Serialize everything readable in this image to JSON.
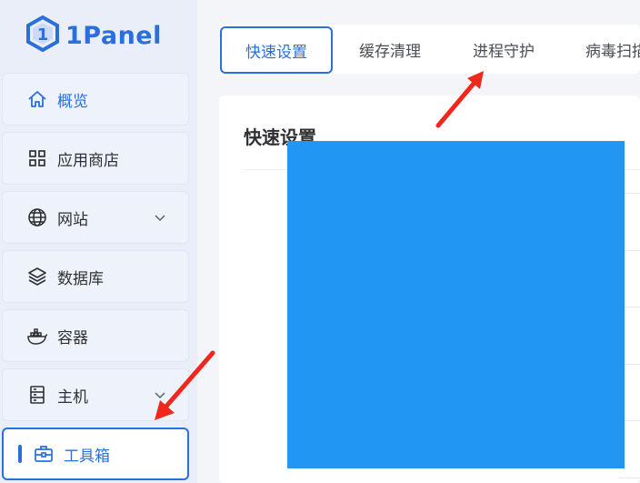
{
  "brand": {
    "name": "1Panel",
    "color": "#2a6fdb"
  },
  "sidebar": {
    "items": [
      {
        "label": "概览",
        "icon": "home-icon"
      },
      {
        "label": "应用商店",
        "icon": "grid-icon"
      },
      {
        "label": "网站",
        "icon": "globe-icon",
        "expandable": true
      },
      {
        "label": "数据库",
        "icon": "layers-icon"
      },
      {
        "label": "容器",
        "icon": "docker-icon"
      },
      {
        "label": "主机",
        "icon": "server-icon",
        "expandable": true
      },
      {
        "label": "工具箱",
        "icon": "toolbox-icon",
        "active": true
      }
    ]
  },
  "tabs": [
    {
      "label": "快速设置",
      "active": true
    },
    {
      "label": "缓存清理"
    },
    {
      "label": "进程守护"
    },
    {
      "label": "病毒扫描"
    }
  ],
  "main": {
    "title": "快速设置"
  },
  "annotation_color": "#f0271d",
  "redaction_color": "#2196f3"
}
